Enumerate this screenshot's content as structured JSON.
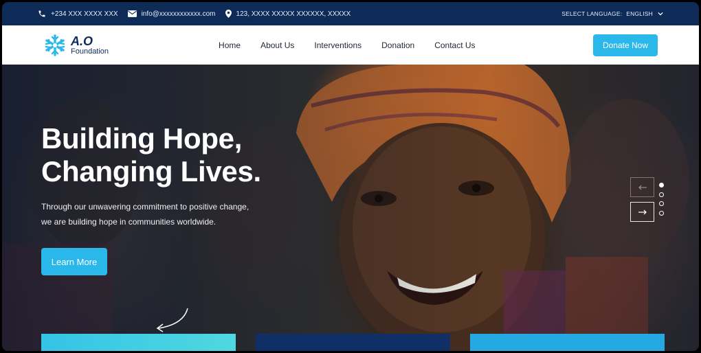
{
  "topbar": {
    "phone": "+234 XXX XXXX XXX",
    "email": "info@xxxxxxxxxxxx.com",
    "address": "123, XXXX XXXXX XXXXXX, XXXXX",
    "language_label": "SELECT LANGUAGE:",
    "language_value": "ENGLISH"
  },
  "header": {
    "logo_line1": "A.O",
    "logo_line2": "Foundation",
    "nav": [
      "Home",
      "About Us",
      "Interventions",
      "Donation",
      "Contact Us"
    ],
    "donate_label": "Donate Now"
  },
  "hero": {
    "title_line1": "Building Hope,",
    "title_line2": "Changing Lives.",
    "desc_line1": "Through our unwavering commitment to positive change,",
    "desc_line2": "we are building hope in communities worldwide.",
    "cta_label": "Learn More",
    "slider_count": 4,
    "slider_active": 1
  },
  "colors": {
    "navy": "#0e2a56",
    "accent": "#2ab7ea",
    "white": "#ffffff"
  }
}
